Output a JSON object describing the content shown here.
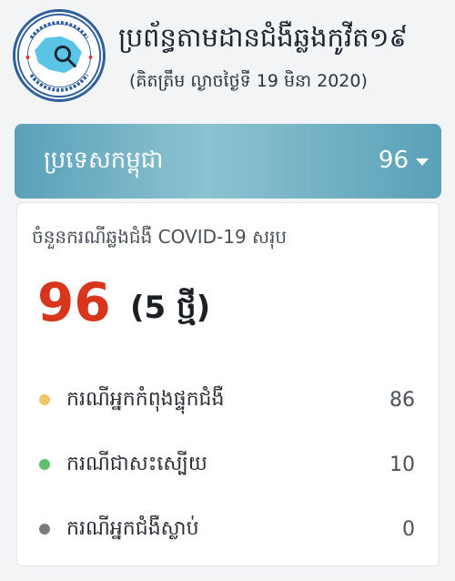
{
  "header": {
    "logo_alt": "ក្រសួងសុខាភិបាល",
    "title": "ប្រព័ន្ធតាមដានជំងឺឆ្លងកូវីត១៩",
    "subtitle": "(គិតត្រឹម ល្ងាចថ្ងៃទី 19 មិនា 2020)"
  },
  "selector": {
    "country": "ប្រទេសកម្ពុជា",
    "value": "96",
    "caret_icon": "caret-down-icon"
  },
  "summary": {
    "heading": "ចំនួនករណីឆ្លងជំងឺ COVID-19 សរុប",
    "total": "96",
    "new_cases": "(5 ថ្មី)"
  },
  "stats": [
    {
      "label": "ករណីអ្នកកំពុងផ្ទុកជំងឺ",
      "value": "86",
      "color": "#f0c463"
    },
    {
      "label": "ករណីជាសះស្បើយ",
      "value": "10",
      "color": "#5ebf6c"
    },
    {
      "label": "ករណីអ្នកជំងឺស្លាប់",
      "value": "0",
      "color": "#7a7a7a"
    }
  ],
  "colors": {
    "accent": "#5aa1b8",
    "total": "#d9341c"
  }
}
